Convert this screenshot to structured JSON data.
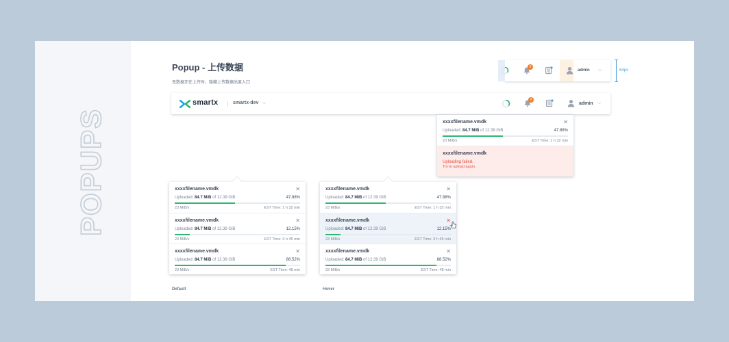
{
  "side_label": "POPUPS",
  "page": {
    "title": "Popup - 上传数据",
    "subtitle": "无数据正在上传时，隐藏上传数据出度入口"
  },
  "header": {
    "brand": "smartx",
    "cluster": "smartx-dev",
    "notification_count": "9",
    "user": "admin",
    "dimension_label": "64px"
  },
  "header_popup": {
    "items": [
      {
        "filename": "xxxxfilename.vmdk",
        "uploaded_label": "Uploaded:",
        "uploaded": "84.7 MiB",
        "of_label": "of",
        "total": "12.39 GiB",
        "percent": "47.88%",
        "progress": 0.4788,
        "speed": "23 MiB/s",
        "est": "EST Time: 1 h 32 min"
      },
      {
        "filename": "xxxxfilename.vmdk",
        "fail_title": "Uploading failed.",
        "fail_sub": "Try to upload again."
      }
    ]
  },
  "panels": [
    {
      "caption": "Default",
      "items": [
        {
          "filename": "xxxxfilename.vmdk",
          "uploaded_label": "Uploaded:",
          "uploaded": "84.7 MiB",
          "of_label": "of",
          "total": "12.39 GiB",
          "percent": "47.88%",
          "progress": 0.4788,
          "speed": "23 MiB/s",
          "est": "EST Time: 1 h 32 min"
        },
        {
          "filename": "xxxxfilename.vmdk",
          "uploaded_label": "Uploaded:",
          "uploaded": "84.7 MiB",
          "of_label": "of",
          "total": "12.39 GiB",
          "percent": "12.15%",
          "progress": 0.1215,
          "speed": "23 MiB/s",
          "est": "EST Time: 3 h 45 min"
        },
        {
          "filename": "xxxxfilename.vmdk",
          "uploaded_label": "Uploaded:",
          "uploaded": "84.7 MiB",
          "of_label": "of",
          "total": "12.39 GiB",
          "percent": "88.52%",
          "progress": 0.8852,
          "speed": "23 MiB/s",
          "est": "EST Time: 48 min"
        }
      ]
    },
    {
      "caption": "Hover",
      "items": [
        {
          "filename": "xxxxfilename.vmdk",
          "uploaded_label": "Uploaded:",
          "uploaded": "84.7 MiB",
          "of_label": "of",
          "total": "12.39 GiB",
          "percent": "47.88%",
          "progress": 0.4788,
          "speed": "23 MiB/s",
          "est": "EST Time: 1 h 32 min"
        },
        {
          "filename": "xxxxfilename.vmdk",
          "uploaded_label": "Uploaded:",
          "uploaded": "84.7 MiB",
          "of_label": "of",
          "total": "12.39 GiB",
          "percent": "12.15%",
          "progress": 0.1215,
          "speed": "23 MiB/s",
          "est": "EST Time: 3 h 45 min"
        },
        {
          "filename": "xxxxfilename.vmdk",
          "uploaded_label": "Uploaded:",
          "uploaded": "84.7 MiB",
          "of_label": "of",
          "total": "12.39 GiB",
          "percent": "88.52%",
          "progress": 0.8852,
          "speed": "23 MiB/s",
          "est": "EST Time: 48 min"
        }
      ]
    }
  ],
  "colors": {
    "progress": "#2bb673",
    "error": "#e6483c",
    "badge": "#f57a24",
    "accent": "#4aa3e0"
  }
}
